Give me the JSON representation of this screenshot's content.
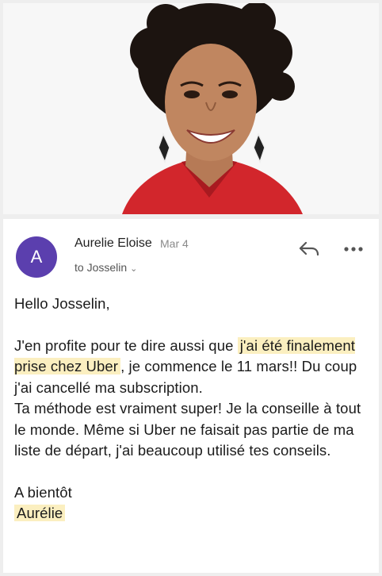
{
  "email": {
    "avatar_letter": "A",
    "sender": "Aurelie Eloise",
    "date": "Mar 4",
    "recipient": "to Josselin",
    "recipient_chevron": "⌄",
    "icons": {
      "reply": "reply-icon",
      "more": "more-horizontal-icon"
    },
    "colors": {
      "avatar": "#5b3fae",
      "highlight": "#fbefc0"
    }
  },
  "body": {
    "greeting": "Hello Josselin,",
    "p1_before": "J'en profite pour te dire aussi que ",
    "p1_highlight": "j'ai été finalement prise chez Uber",
    "p1_after": ", je commence le 11 mars!! Du coup j'ai cancellé ma subscription.",
    "p2": "Ta méthode est vraiment super! Je la conseille à tout le monde. Même si Uber ne faisait pas partie de ma liste de départ, j'ai beaucoup utilisé tes conseils.",
    "closing": "A bientôt",
    "signature": "Aurélie"
  }
}
